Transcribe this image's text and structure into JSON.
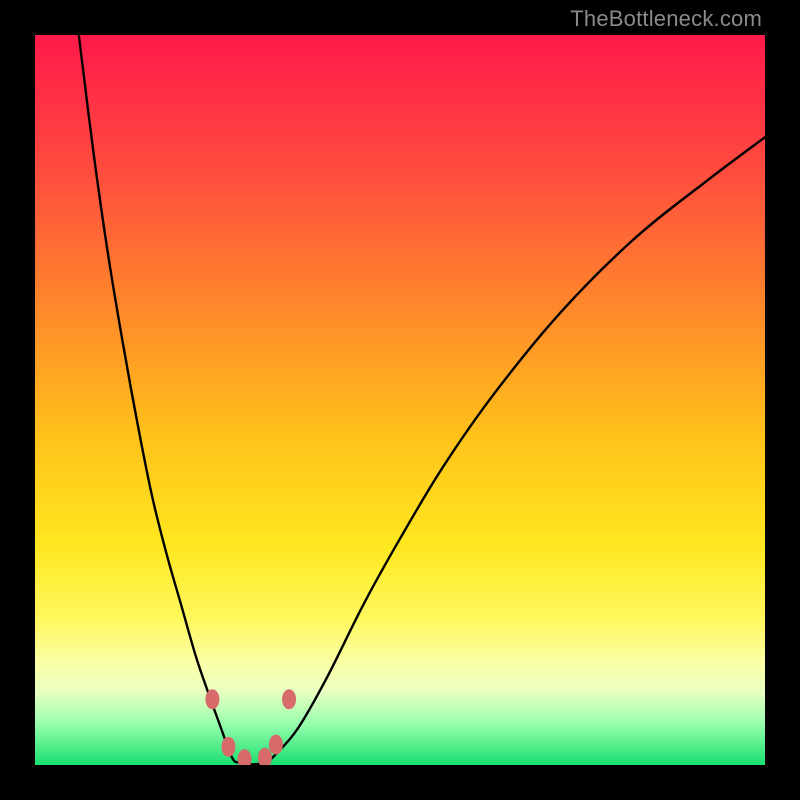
{
  "watermark": "TheBottleneck.com",
  "colors": {
    "frame": "#000000",
    "curve": "#000000",
    "marker": "#d76a6a",
    "gradient_stops": [
      {
        "pct": 0,
        "color": "#ff1a4b"
      },
      {
        "pct": 18,
        "color": "#ff4a3f"
      },
      {
        "pct": 38,
        "color": "#ff8a2a"
      },
      {
        "pct": 55,
        "color": "#ffc21a"
      },
      {
        "pct": 70,
        "color": "#ffe820"
      },
      {
        "pct": 80,
        "color": "#fff85e"
      },
      {
        "pct": 86,
        "color": "#fbffa6"
      },
      {
        "pct": 90,
        "color": "#e8ffc0"
      },
      {
        "pct": 94,
        "color": "#9fffb0"
      },
      {
        "pct": 100,
        "color": "#18e070"
      }
    ]
  },
  "chart_data": {
    "type": "line",
    "title": "",
    "xlabel": "",
    "ylabel": "",
    "xlim": [
      0,
      100
    ],
    "ylim": [
      0,
      100
    ],
    "grid": false,
    "legend": false,
    "annotations": [],
    "series": [
      {
        "name": "left-branch",
        "x": [
          6,
          8,
          10,
          12,
          14,
          16,
          18,
          20,
          22,
          23.7,
          25.5,
          27
        ],
        "y": [
          100,
          84,
          70,
          58,
          47,
          37,
          29,
          22,
          15,
          10,
          5,
          1
        ]
      },
      {
        "name": "valley",
        "x": [
          27,
          28,
          29,
          30,
          31,
          32,
          33
        ],
        "y": [
          1,
          0.3,
          0.1,
          0.1,
          0.2,
          0.6,
          1.5
        ]
      },
      {
        "name": "right-branch",
        "x": [
          33,
          36,
          40,
          45,
          50,
          56,
          63,
          72,
          82,
          92,
          100
        ],
        "y": [
          1.5,
          5,
          12,
          22,
          31,
          41,
          51,
          62,
          72,
          80,
          86
        ]
      }
    ],
    "markers": {
      "name": "valley-markers",
      "points": [
        {
          "x": 24.3,
          "y": 9.0
        },
        {
          "x": 26.5,
          "y": 2.5
        },
        {
          "x": 28.7,
          "y": 0.8
        },
        {
          "x": 31.5,
          "y": 1.0
        },
        {
          "x": 33.0,
          "y": 2.8
        },
        {
          "x": 34.8,
          "y": 9.0
        }
      ]
    }
  }
}
